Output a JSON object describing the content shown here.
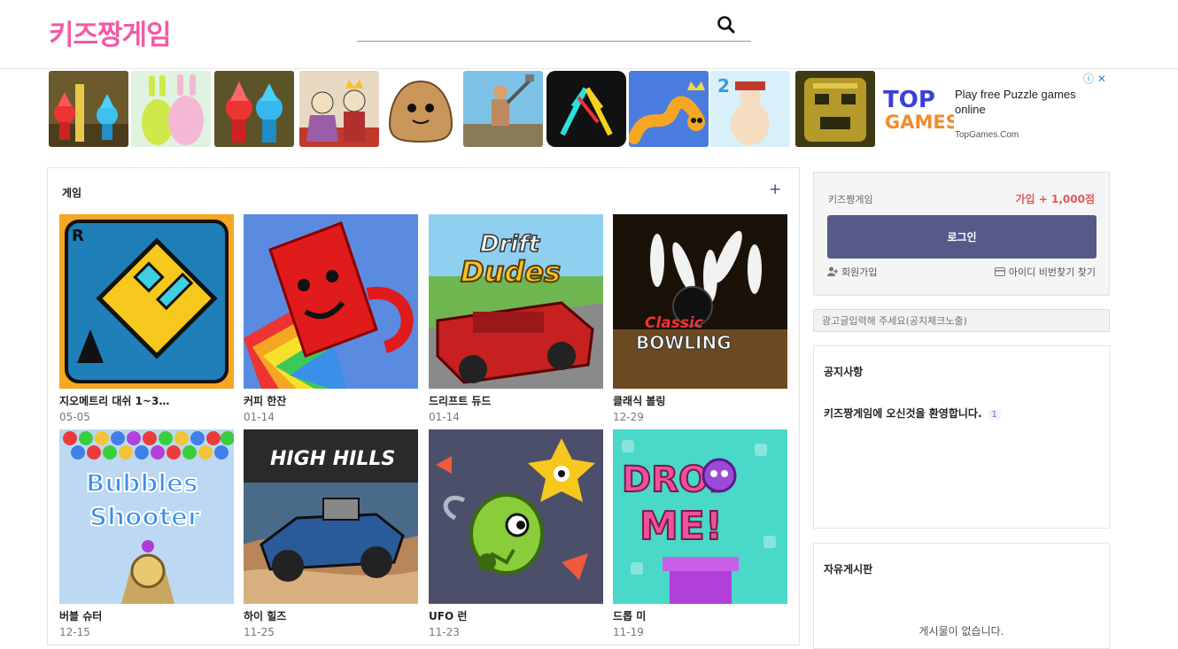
{
  "header": {
    "logo": "키즈짱게임",
    "search_placeholder": "",
    "search_icon": "search-icon"
  },
  "ad": {
    "thumbnails": [
      "fireboy-watergirl-1",
      "super-bunny-man",
      "fireboy-watergirl",
      "stick-king",
      "pou",
      "getting-over-it",
      "stickman-duel",
      "snake-crown",
      "draw-2",
      "temple-run"
    ],
    "brand_top": "TOP",
    "brand_bottom": "GAMES",
    "text": "Play free Puzzle games online",
    "domain": "TopGames.Com",
    "info": "ⓘ ✕",
    "colors": {
      "brand": "#3a3fd8",
      "info": "#2a8be2"
    }
  },
  "games_panel": {
    "title": "게임",
    "plus": "+",
    "games": [
      {
        "title": "지오메트리 대쉬 1~3…",
        "date": "05-05",
        "art": "geometry-dash"
      },
      {
        "title": "커피 한잔",
        "date": "01-14",
        "art": "coffee-cup"
      },
      {
        "title": "드리프트 듀드",
        "date": "01-14",
        "art": "drift-dudes"
      },
      {
        "title": "클래식 볼링",
        "date": "12-29",
        "art": "classic-bowling"
      },
      {
        "title": "버블 슈터",
        "date": "12-15",
        "art": "bubbles-shooter"
      },
      {
        "title": "하이 힐즈",
        "date": "11-25",
        "art": "high-hills"
      },
      {
        "title": "UFO 런",
        "date": "11-23",
        "art": "ufo-run"
      },
      {
        "title": "드롭 미",
        "date": "11-19",
        "art": "drop-me"
      }
    ],
    "art_text": {
      "drift": "Drift",
      "dudes": "Dudes",
      "classic": "Classic",
      "bowling": "BOWLING",
      "bubbles": "Bubbles",
      "shooter": "Shooter",
      "high_hills": "HIGH HILLS",
      "drop": "DROP",
      "me": "ME!"
    }
  },
  "login": {
    "site": "키즈짱게임",
    "promo": "가입 + 1,000점",
    "button": "로그인",
    "join": "회원가입",
    "find": "아이디 비번찾기 찾기",
    "colors": {
      "button": "#565a88",
      "promo": "#e05a5a"
    }
  },
  "ad_input": {
    "placeholder": "광고글입력해 주세요(공치체크노출)"
  },
  "notice": {
    "title": "공지사항",
    "item": "키즈짱게임에 오신것을 환영합니다.",
    "count": "1"
  },
  "free_board": {
    "title": "자유게시판",
    "empty": "게시물이 없습니다."
  }
}
